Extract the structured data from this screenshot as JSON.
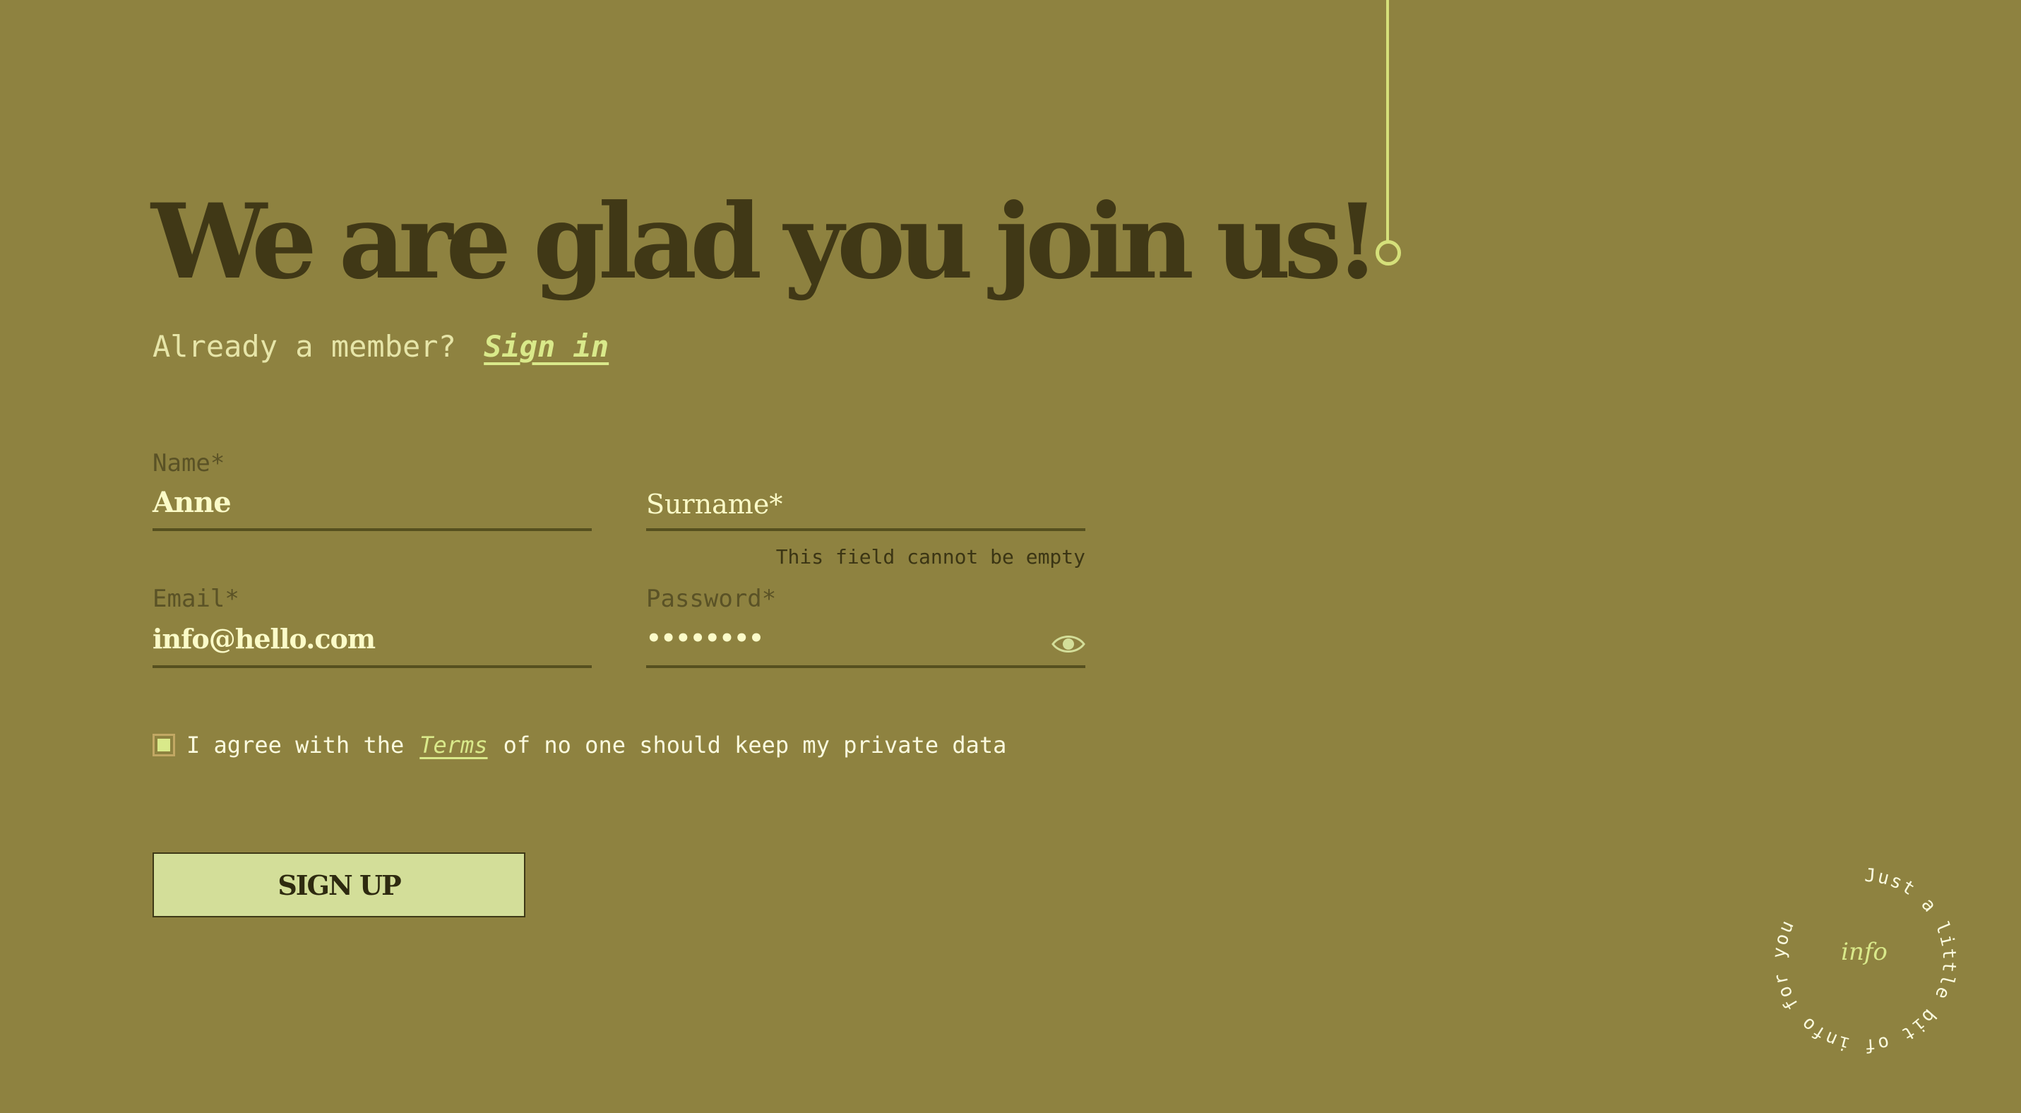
{
  "headline": "We are glad you join us!",
  "member_prompt": {
    "text": "Already a member?",
    "link": "Sign in"
  },
  "form": {
    "name": {
      "label": "Name*",
      "value": "Anne"
    },
    "surname": {
      "placeholder": "Surname*",
      "error": "This field cannot be empty"
    },
    "email": {
      "label": "Email*",
      "value": "info@hello.com"
    },
    "password": {
      "label": "Password*",
      "value": "••••••••",
      "toggle_icon": "eye-icon"
    },
    "agree": {
      "prefix": "I agree with the",
      "link": "Terms",
      "suffix": "of no one should keep my private data",
      "checked": true
    },
    "submit_label": "SIGN UP"
  },
  "badge": {
    "ring_text": "Just a little bit of info for you",
    "center": "info"
  },
  "colors": {
    "background": "#8e8240",
    "accent": "#d9e98a",
    "headline": "#403816",
    "button": "#d3de99"
  }
}
